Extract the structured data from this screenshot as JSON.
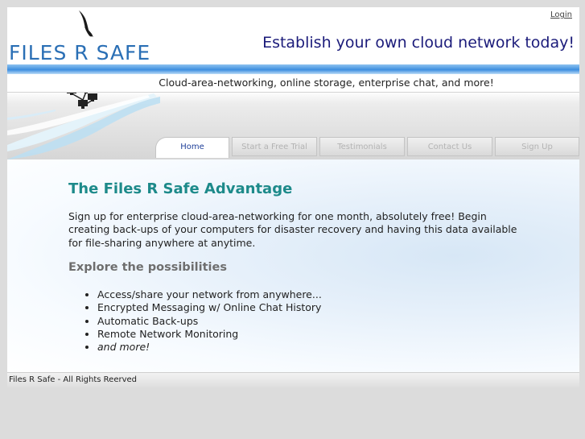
{
  "header": {
    "login_label": "Login",
    "logo_text": "FILES R SAFE",
    "tagline": "Establish your own cloud network today!"
  },
  "banner": {
    "subtitle": "Cloud-area-networking, online storage, enterprise chat, and more!"
  },
  "nav": {
    "tabs": [
      {
        "label": "Home",
        "active": true
      },
      {
        "label": "Start a Free Trial",
        "active": false
      },
      {
        "label": "Testimonials",
        "active": false
      },
      {
        "label": "Contact Us",
        "active": false
      },
      {
        "label": "Sign Up",
        "active": false
      }
    ]
  },
  "main": {
    "title": "The Files R Safe Advantage",
    "intro": "Sign up for enterprise cloud-area-networking for one month, absolutely free! Begin creating back-ups of your computers for disaster recovery and having this data available for file-sharing anywhere at anytime.",
    "subtitle": "Explore the possibilities",
    "features": [
      "Access/share your network from anywhere...",
      "Encrypted Messaging w/ Online Chat History",
      "Automatic Back-ups",
      "Remote Network Monitoring",
      "and more!"
    ]
  },
  "footer": {
    "text": "Files R Safe - All Rights Reerved"
  },
  "colors": {
    "page_background": "#dcdcdc",
    "brand_blue": "#2a6fb5",
    "tagline_navy": "#1b1b7a",
    "heading_teal": "#1d8a8a",
    "active_tab_text": "#1f3f99"
  }
}
